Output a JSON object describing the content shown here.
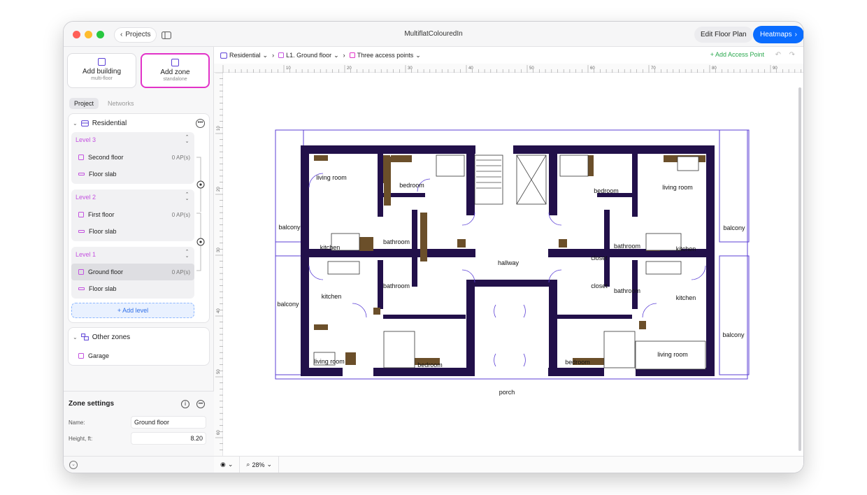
{
  "window": {
    "title": "MultiflatColouredIn",
    "back_label": "Projects"
  },
  "toolbar": {
    "edit_label": "Edit Floor Plan",
    "heatmaps_label": "Heatmaps"
  },
  "sidebar": {
    "add_building": {
      "title": "Add building",
      "subtitle": "multi-floor"
    },
    "add_zone": {
      "title": "Add zone",
      "subtitle": "standalone"
    },
    "tabs": [
      "Project",
      "Networks"
    ],
    "building": {
      "name": "Residential",
      "levels": [
        {
          "title": "Level 3",
          "items": [
            {
              "label": "Second floor",
              "ap": "0 AP(s)"
            },
            {
              "label": "Floor slab"
            }
          ]
        },
        {
          "title": "Level 2",
          "items": [
            {
              "label": "First floor",
              "ap": "0 AP(s)"
            },
            {
              "label": "Floor slab"
            }
          ]
        },
        {
          "title": "Level 1",
          "items": [
            {
              "label": "Ground floor",
              "ap": "0 AP(s)"
            },
            {
              "label": "Floor slab"
            }
          ]
        }
      ],
      "add_level": "+ Add level"
    },
    "other_zones": {
      "title": "Other zones",
      "items": [
        "Garage"
      ]
    }
  },
  "zone_settings": {
    "title": "Zone settings",
    "name_label": "Name:",
    "name_value": "Ground floor",
    "height_label": "Height, ft:",
    "height_value": "8.20"
  },
  "breadcrumb": {
    "building": "Residential",
    "level": "L1. Ground floor",
    "view": "Three access points"
  },
  "actions": {
    "add_access_point": "+ Add Access Point"
  },
  "ruler": {
    "h": [
      "10",
      "20",
      "30",
      "40",
      "50",
      "60",
      "70",
      "80",
      "90"
    ],
    "v": [
      "10",
      "20",
      "30",
      "40",
      "50",
      "60"
    ]
  },
  "plan_labels": {
    "living_room": "living room",
    "bedroom": "bedroom",
    "balcony": "balcony",
    "kitchen": "kitchen",
    "bathroom": "bathroom",
    "hallway": "hallway",
    "closet": "closet",
    "porch": "porch"
  },
  "bottom": {
    "zoom": "28%"
  },
  "colors": {
    "accent": "#0a6cff",
    "selection": "#e233c8",
    "wall": "#22104a",
    "zone": "#5b3fd6"
  }
}
